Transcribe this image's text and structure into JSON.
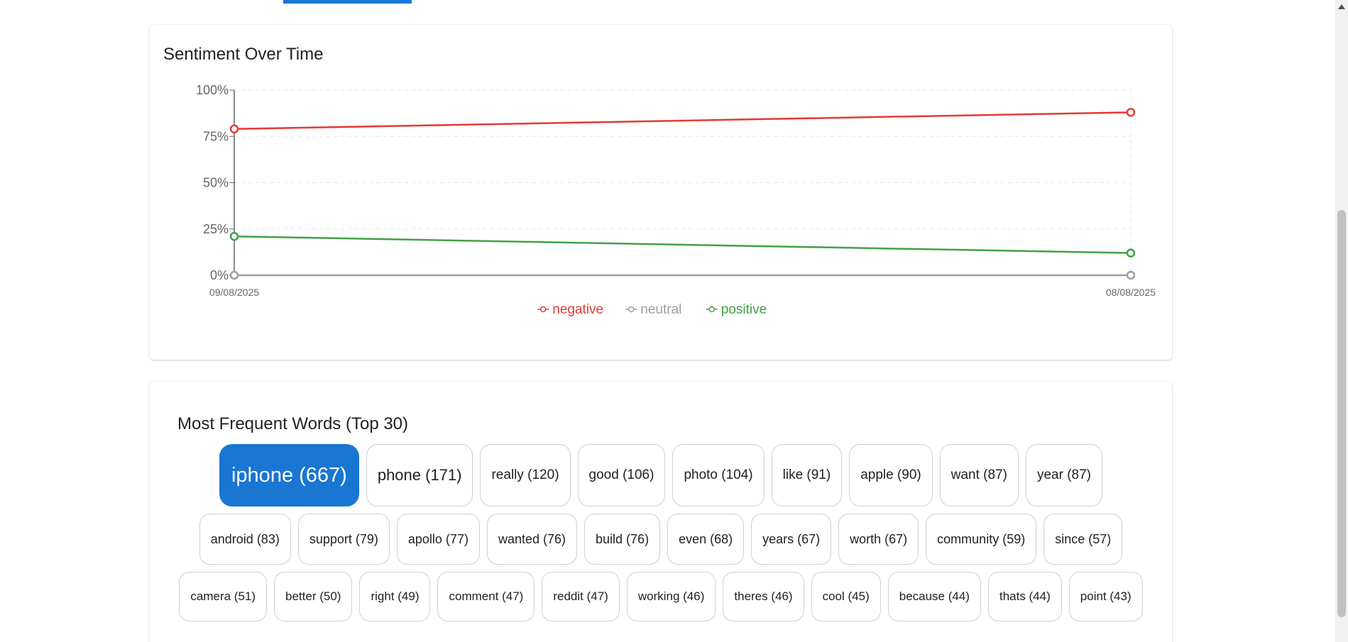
{
  "chart_card": {
    "title": "Sentiment Over Time"
  },
  "chart_data": {
    "type": "line",
    "title": "Sentiment Over Time",
    "x": [
      "09/08/2025",
      "08/08/2025"
    ],
    "y_ticks": [
      "0%",
      "25%",
      "50%",
      "75%",
      "100%"
    ],
    "ylim": [
      0,
      100
    ],
    "grid": true,
    "legend_position": "bottom-center",
    "series": [
      {
        "name": "negative",
        "values": [
          79,
          88
        ],
        "color": "#e53935"
      },
      {
        "name": "neutral",
        "values": [
          0,
          0
        ],
        "color": "#9e9e9e"
      },
      {
        "name": "positive",
        "values": [
          21,
          12
        ],
        "color": "#43a047"
      }
    ]
  },
  "words_card": {
    "title": "Most Frequent Words (Top 30)",
    "rows": [
      [
        "iphone (667)",
        "phone (171)",
        "really (120)",
        "good (106)",
        "photo (104)",
        "like (91)",
        "apple (90)",
        "want (87)",
        "year (87)"
      ],
      [
        "android (83)",
        "support (79)",
        "apollo (77)",
        "wanted (76)",
        "build (76)",
        "even (68)",
        "years (67)",
        "worth (67)",
        "community (59)",
        "since (57)"
      ],
      [
        "camera (51)",
        "better (50)",
        "right (49)",
        "comment (47)",
        "reddit (47)",
        "working (46)",
        "theres (46)",
        "cool (45)",
        "because (44)",
        "thats (44)",
        "point (43)"
      ]
    ],
    "highlight_color": "#1976d2"
  }
}
